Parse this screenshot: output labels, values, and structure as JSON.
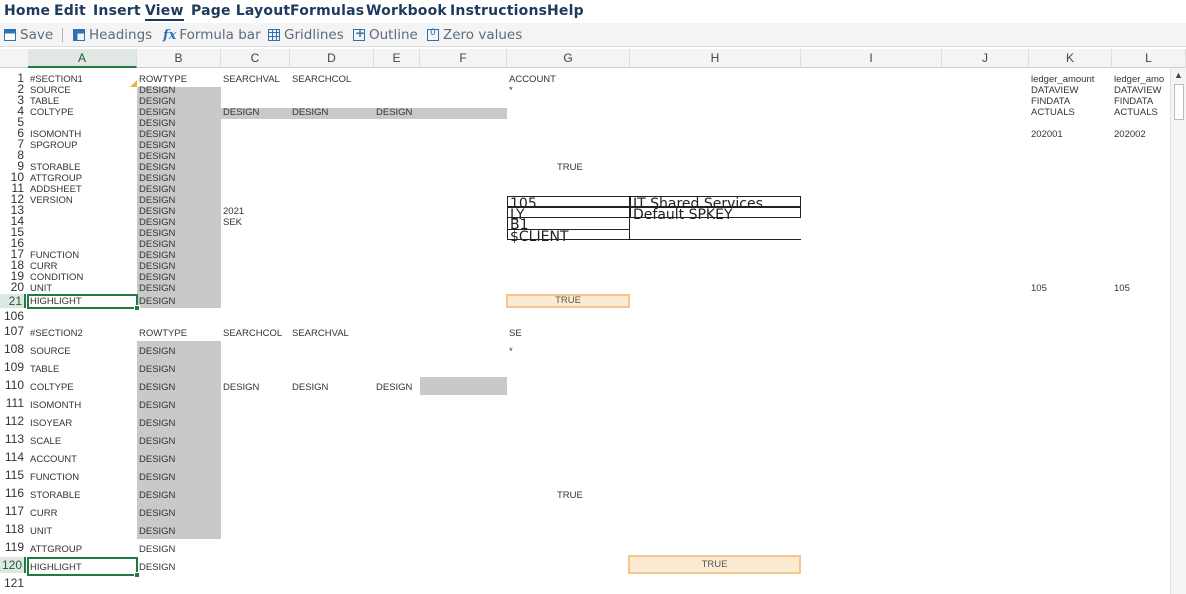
{
  "menu": [
    "Home",
    "Edit",
    "Insert",
    "View",
    "Page Layout",
    "Formulas",
    "Workbook",
    "Instructions",
    "Help"
  ],
  "toolbar": {
    "save": "Save",
    "headings": "Headings",
    "formula_bar": "Formula bar",
    "gridlines": "Gridlines",
    "outline": "Outline",
    "zero_values": "Zero values"
  },
  "columns": [
    "A",
    "B",
    "C",
    "D",
    "E",
    "F",
    "G",
    "H",
    "I",
    "J",
    "K",
    "L"
  ],
  "rows": [
    "1",
    "2",
    "3",
    "4",
    "5",
    "6",
    "7",
    "8",
    "9",
    "10",
    "11",
    "12",
    "13",
    "14",
    "15",
    "16",
    "17",
    "18",
    "19",
    "20",
    "21",
    "106",
    "107",
    "108",
    "109",
    "110",
    "111",
    "112",
    "113",
    "114",
    "115",
    "116",
    "117",
    "118",
    "119",
    "120",
    "121"
  ],
  "section1": {
    "A": [
      "#SECTION1",
      "SOURCE",
      "TABLE",
      "COLTYPE",
      "",
      "ISOMONTH",
      "SPGROUP",
      "",
      "STORABLE",
      "ATTGROUP",
      "ADDSHEET",
      "VERSION",
      "",
      "",
      "",
      "",
      "FUNCTION",
      "CURR",
      "CONDITION",
      "UNIT",
      "HIGHLIGHT"
    ],
    "B_header": "ROWTYPE",
    "B_value": "DESIGN",
    "C1": "SEARCHVAL",
    "D1": "SEARCHCOL",
    "C4": "DESIGN",
    "D4": "DESIGN",
    "E4": "DESIGN",
    "C13": "2021",
    "C14": "SEK",
    "G1": "ACCOUNT",
    "G2": "*",
    "G9": "TRUE",
    "G21": "TRUE",
    "G13": "105",
    "G14": "LY",
    "G15": "B1",
    "G16": "$CLIENT",
    "H13": "IT Shared Services",
    "H14": "Default SPKEY",
    "K": [
      "ledger_amount",
      "DATAVIEW",
      "FINDATA",
      "ACTUALS",
      "",
      "202001"
    ],
    "L": [
      "ledger_amo",
      "DATAVIEW",
      "FINDATA",
      "ACTUALS",
      "",
      "202002"
    ],
    "K20": "105",
    "L20": "105"
  },
  "section2": {
    "A": [
      "#SECTION2",
      "SOURCE",
      "TABLE",
      "COLTYPE",
      "ISOMONTH",
      "ISOYEAR",
      "SCALE",
      "ACCOUNT",
      "FUNCTION",
      "STORABLE",
      "CURR",
      "UNIT",
      "ATTGROUP",
      "HIGHLIGHT"
    ],
    "B_header": "ROWTYPE",
    "B_value": "DESIGN",
    "C107": "SEARCHCOL",
    "D107": "SEARCHVAL",
    "C110": "DESIGN",
    "D110": "DESIGN",
    "E110": "DESIGN",
    "G107": "SE",
    "G108": "*",
    "G116": "TRUE",
    "H120": "TRUE"
  }
}
